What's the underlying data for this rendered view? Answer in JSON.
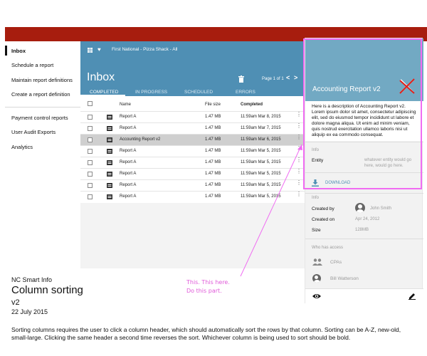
{
  "sidebar": {
    "items": [
      {
        "label": "Inbox"
      },
      {
        "label": "Schedule a report"
      },
      {
        "label": "Maintain report definitions"
      },
      {
        "label": "Create a report definition"
      },
      {
        "label": "Payment control reports"
      },
      {
        "label": "User Audit Exports"
      },
      {
        "label": "Analytics"
      }
    ]
  },
  "header": {
    "breadcrumb": "First National - Pizza Shack - All",
    "title": "Inbox",
    "pager": "Page 1 of 1",
    "prev": "<",
    "next": ">",
    "tabs": [
      {
        "label": "COMPLETED"
      },
      {
        "label": "IN PROGRESS"
      },
      {
        "label": "SCHEDULED"
      },
      {
        "label": "ERRORS"
      }
    ]
  },
  "table": {
    "columns": {
      "name": "Name",
      "size": "File size",
      "completed": "Completed"
    },
    "rows": [
      {
        "name": "Report A",
        "size": "1.47 MB",
        "completed": "11:59am Mar 8, 2015"
      },
      {
        "name": "Report A",
        "size": "1.47 MB",
        "completed": "11:59am Mar 7, 2015"
      },
      {
        "name": "Accounting Report v2",
        "size": "1.47 MB",
        "completed": "11:59am Mar 6, 2015"
      },
      {
        "name": "Report A",
        "size": "1.47 MB",
        "completed": "11:59am Mar 5, 2015"
      },
      {
        "name": "Report A",
        "size": "1.47 MB",
        "completed": "11:59am Mar 5, 2015"
      },
      {
        "name": "Report A",
        "size": "1.47 MB",
        "completed": "11:59am Mar 5, 2015"
      },
      {
        "name": "Report A",
        "size": "1.47 MB",
        "completed": "11:59am Mar 5, 2015"
      },
      {
        "name": "Report A",
        "size": "1.47 MB",
        "completed": "11:59am Mar 5, 2015"
      }
    ]
  },
  "detail": {
    "title": "Accounting Report v2",
    "description": "Here is a description of Accounting Report v2. Lorem ipsum dolor sit amet, consectetur adipiscing elit, sed do eiusmod tempor incididunt ut labore et dolore magna aliqua. Ut enim ad minim veniam, quis nostrud exercitation ullamco laboris nisi ut aliquip ex ea commodo consequat.",
    "info_label": "Info",
    "entity_key": "Entity",
    "entity_value": "whatever entity would go here, would go here.",
    "download_label": "DOWNLOAD",
    "info2_label": "Info",
    "created_by_key": "Created by",
    "created_by_value": "John Smith",
    "created_on_key": "Created on",
    "created_on_value": "Apr 24, 2012",
    "size_key": "Size",
    "size_value": "128MB",
    "access_label": "Who has access",
    "access": [
      {
        "name": "CPAs"
      },
      {
        "name": "Bill Watterson"
      }
    ]
  },
  "annotation": {
    "line1": "This. This here.",
    "line2": "Do this part."
  },
  "notes": {
    "app": "NC Smart Info",
    "title": "Column sorting",
    "version": "v2",
    "date": "22 July 2015",
    "body": "Sorting columns requires the user to click a column header, which should automatically sort the rows by that column. Sorting can be A-Z, new-old, small-large. Clicking the same header a second time reverses the sort. Whichever column is being used to sort should be bold."
  },
  "colors": {
    "topbar": "#a71d0e",
    "header": "#4f8fb4",
    "detail_header": "#72a9c3",
    "annotation": "#f06cf2"
  }
}
